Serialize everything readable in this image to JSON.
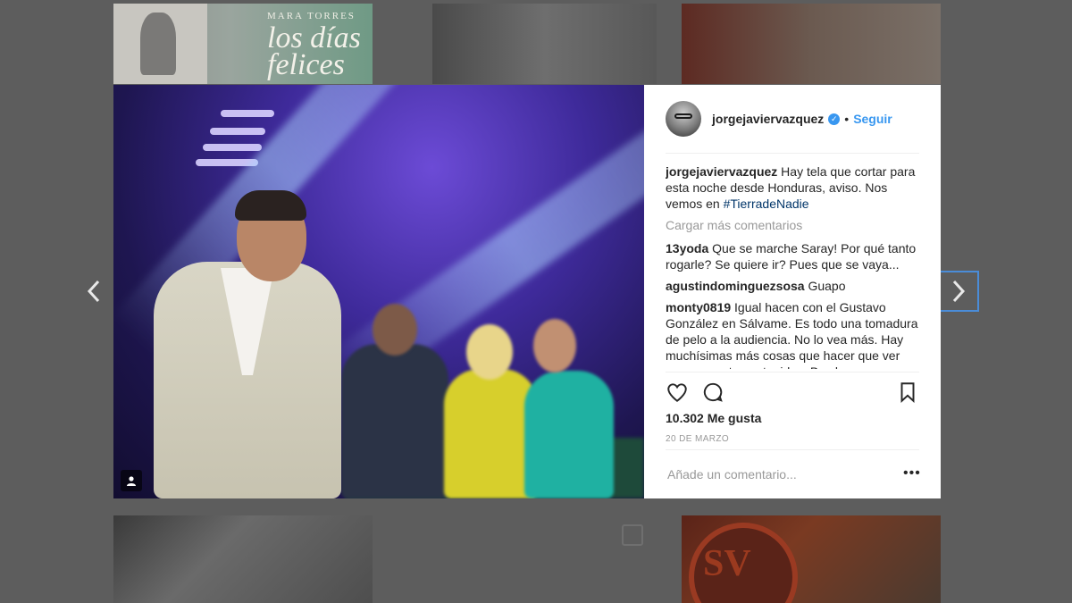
{
  "grid": {
    "book_author": "MARA TORRES",
    "book_title": "los días felices",
    "sv_logo": "SV"
  },
  "post": {
    "username": "jorgejaviervazquez",
    "follow_label": "Seguir",
    "separator": "•",
    "caption_user": "jorgejaviervazquez",
    "caption_text": " Hay tela que cortar para esta noche desde Honduras, aviso. Nos vemos en ",
    "caption_hashtag": "#TierradeNadie",
    "load_more": "Cargar más comentarios",
    "comments": [
      {
        "user": "13yoda",
        "text": " Que se marche Saray! Por qué tanto rogarle? Se quiere ir? Pues que se vaya..."
      },
      {
        "user": "agustindominguezsosa",
        "text": " Guapo"
      },
      {
        "user": "monty0819",
        "text": " Igual hacen con el Gustavo González en Sálvame. Es todo una tomadura de pelo a la audiencia. No lo vea más. Hay muchísimas más cosas que hacer que ver programas tan estupidos. Bye bye"
      }
    ],
    "likes": "10.302 Me gusta",
    "date": "20 DE MARZO",
    "add_comment_placeholder": "Añade un comentario...",
    "more_options": "•••"
  },
  "icons": {
    "prev": "chevron-left-icon",
    "next": "chevron-right-icon",
    "like": "heart-icon",
    "comment": "comment-icon",
    "save": "bookmark-icon",
    "verified": "verified-badge-icon",
    "tagged_user": "user-tag-icon"
  },
  "colors": {
    "accent": "#3897f0",
    "hashtag": "#003569",
    "text": "#262626",
    "muted": "#999999",
    "overlay": "#5d5d5d"
  }
}
